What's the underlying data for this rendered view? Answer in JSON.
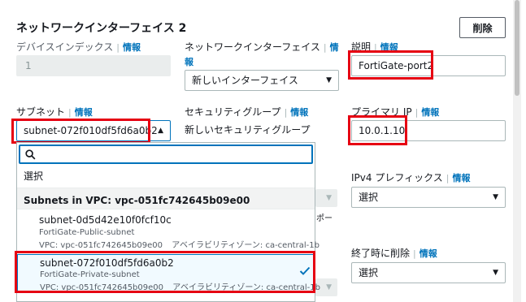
{
  "section": {
    "title": "ネットワークインターフェイス 2",
    "delete_label": "削除"
  },
  "info_label": "情報",
  "device_index": {
    "label": "デバイスインデックス",
    "value": "1"
  },
  "network_interface": {
    "label_line1": "ネットワークインターフェイス",
    "info_part1": "情",
    "info_part2": "報",
    "value": "新しいインターフェイス"
  },
  "description": {
    "label": "説明",
    "value": "FortiGate-port2"
  },
  "subnet": {
    "label": "サブネット",
    "value": "subnet-072f010df5fd6a0b2"
  },
  "security_group": {
    "label": "セキュリティグループ",
    "value": "新しいセキュリティグループ"
  },
  "primary_ip": {
    "label": "プライマリ IP",
    "value": "10.0.1.10"
  },
  "ipv4_prefix": {
    "label": "IPv4 プレフィックス",
    "value": "選択"
  },
  "delete_on_termination": {
    "label": "終了時に削除",
    "value": "選択"
  },
  "hidden_fragment": "ポー",
  "dropdown": {
    "search_placeholder": "",
    "select_option": "選択",
    "group_header": "Subnets in VPC: vpc-051fc742645b09e00",
    "options": [
      {
        "id": "subnet-0d5d42e10f0fcf10c",
        "name": "FortiGate-Public-subnet",
        "vpc": "VPC: vpc-051fc742645b09e00",
        "az": "アベイラビリティゾーン: ca-central-1b",
        "selected": false
      },
      {
        "id": "subnet-072f010df5fd6a0b2",
        "name": "FortiGate-Private-subnet",
        "vpc": "VPC: vpc-051fc742645b09e00",
        "az": "アベイラビリティゾーン: ca-central-1b",
        "selected": true
      }
    ]
  },
  "colors": {
    "highlight_red": "#e60012",
    "link_blue": "#0073bb",
    "check_blue": "#0073bb"
  },
  "icons": [
    "search-icon",
    "caret-down-icon",
    "caret-up-icon",
    "check-icon"
  ]
}
